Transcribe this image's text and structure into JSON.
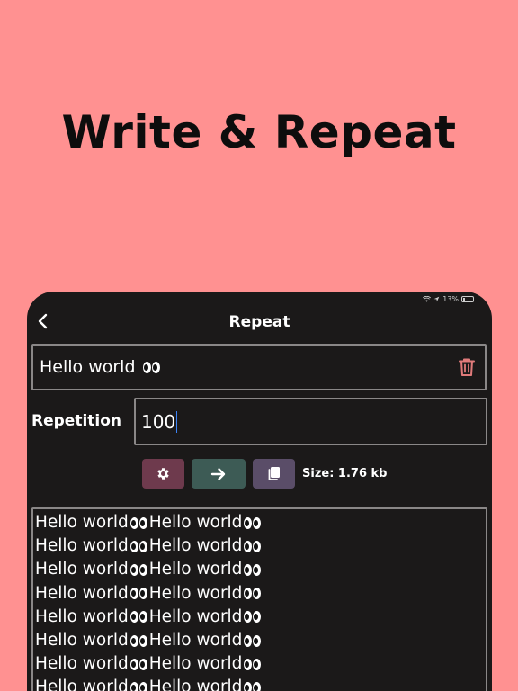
{
  "headline": "Write & Repeat",
  "status_bar": {
    "battery": "13%"
  },
  "nav": {
    "title": "Repeat"
  },
  "input": {
    "text": "Hello world",
    "emoji": "eyes"
  },
  "repetition": {
    "label": "Repetition",
    "value": "100"
  },
  "toolbar": {
    "settings_icon": "gear-icon",
    "run_icon": "arrow-right-icon",
    "copy_icon": "copy-icon",
    "size_label": "Size: 1.76 kb"
  },
  "output": {
    "lines": [
      [
        "Hello world",
        "Hello world"
      ],
      [
        "Hello world",
        "Hello world"
      ],
      [
        "Hello world",
        "Hello world"
      ],
      [
        "Hello world",
        "Hello world"
      ],
      [
        "Hello world",
        "Hello world"
      ],
      [
        "Hello world",
        "Hello world"
      ],
      [
        "Hello world",
        "Hello world"
      ],
      [
        "Hello world",
        "Hello world"
      ]
    ]
  },
  "colors": {
    "background": "#FF9191",
    "device": "#1b1919",
    "settings_button": "#6e3a4d",
    "run_button": "#3d5b55",
    "copy_button": "#5a4d68",
    "trash_icon": "#e07a7a"
  }
}
